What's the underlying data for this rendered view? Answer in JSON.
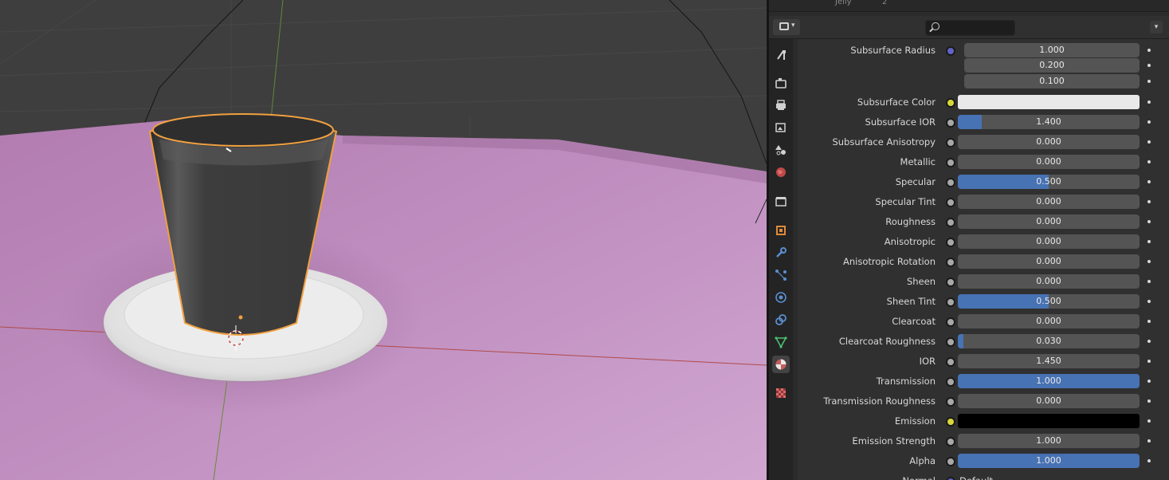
{
  "outliner": {
    "fragment_1": "Jelly",
    "fragment_2": "2"
  },
  "header": {
    "search_value": "",
    "editor_type_icon": "properties-editor-icon"
  },
  "tabs": [
    {
      "name": "tool-tab",
      "icon": "wrench-screwdriver-icon",
      "active": false
    },
    {
      "name": "render-tab",
      "icon": "camera-back-icon",
      "active": false
    },
    {
      "name": "output-tab",
      "icon": "printer-icon",
      "active": false
    },
    {
      "name": "view-layer-tab",
      "icon": "image-stack-icon",
      "active": false
    },
    {
      "name": "scene-tab",
      "icon": "cone-sphere-icon",
      "active": false
    },
    {
      "name": "world-tab",
      "icon": "globe-icon",
      "active": false
    },
    {
      "name": "collection-tab",
      "icon": "box-icon",
      "active": false
    },
    {
      "name": "object-tab",
      "icon": "orange-square-icon",
      "active": false
    },
    {
      "name": "modifier-tab",
      "icon": "wrench-icon",
      "active": false
    },
    {
      "name": "particles-tab",
      "icon": "particles-icon",
      "active": false
    },
    {
      "name": "physics-tab",
      "icon": "physics-orbit-icon",
      "active": false
    },
    {
      "name": "constraints-tab",
      "icon": "constraint-icon",
      "active": false
    },
    {
      "name": "data-tab",
      "icon": "triangle-mesh-icon",
      "active": false
    },
    {
      "name": "material-tab",
      "icon": "material-sphere-icon",
      "active": true
    },
    {
      "name": "texture-tab",
      "icon": "checker-texture-icon",
      "active": false
    }
  ],
  "material": {
    "subsurface_radius": {
      "label": "Subsurface Radius",
      "values": [
        "1.000",
        "0.200",
        "0.100"
      ]
    },
    "rows": [
      {
        "label": "Subsurface Color",
        "kind": "color",
        "color": "#e9e9e9",
        "socket": "#d8d83a"
      },
      {
        "label": "Subsurface IOR",
        "value": "1.400",
        "fill": 0.13,
        "socket": "#a8a8a8"
      },
      {
        "label": "Subsurface Anisotropy",
        "value": "0.000",
        "fill": 0,
        "socket": "#a8a8a8"
      },
      {
        "label": "Metallic",
        "value": "0.000",
        "fill": 0,
        "socket": "#a8a8a8"
      },
      {
        "label": "Specular",
        "value": "0.500",
        "fill": 0.5,
        "socket": "#a8a8a8"
      },
      {
        "label": "Specular Tint",
        "value": "0.000",
        "fill": 0,
        "socket": "#a8a8a8"
      },
      {
        "label": "Roughness",
        "value": "0.000",
        "fill": 0,
        "socket": "#a8a8a8"
      },
      {
        "label": "Anisotropic",
        "value": "0.000",
        "fill": 0,
        "socket": "#a8a8a8"
      },
      {
        "label": "Anisotropic Rotation",
        "value": "0.000",
        "fill": 0,
        "socket": "#a8a8a8"
      },
      {
        "label": "Sheen",
        "value": "0.000",
        "fill": 0,
        "socket": "#a8a8a8"
      },
      {
        "label": "Sheen Tint",
        "value": "0.500",
        "fill": 0.5,
        "socket": "#a8a8a8"
      },
      {
        "label": "Clearcoat",
        "value": "0.000",
        "fill": 0,
        "socket": "#a8a8a8"
      },
      {
        "label": "Clearcoat Roughness",
        "value": "0.030",
        "fill": 0.03,
        "socket": "#a8a8a8"
      },
      {
        "label": "IOR",
        "value": "1.450",
        "fill": 0,
        "socket": "#a8a8a8"
      },
      {
        "label": "Transmission",
        "value": "1.000",
        "fill": 1,
        "socket": "#a8a8a8"
      },
      {
        "label": "Transmission Roughness",
        "value": "0.000",
        "fill": 0,
        "socket": "#a8a8a8"
      },
      {
        "label": "Emission",
        "kind": "color",
        "color": "#000000",
        "socket": "#d8d83a"
      },
      {
        "label": "Emission Strength",
        "value": "1.000",
        "fill": 0,
        "socket": "#a8a8a8"
      },
      {
        "label": "Alpha",
        "value": "1.000",
        "fill": 1,
        "socket": "#a8a8a8"
      },
      {
        "label": "Normal",
        "kind": "link",
        "value": "Default",
        "socket": "#6363c7"
      }
    ]
  },
  "colors": {
    "accent": "#4772b3",
    "field": "#545454",
    "panel": "#303030",
    "floor": "#c79ac4",
    "selection": "#f0a040"
  }
}
